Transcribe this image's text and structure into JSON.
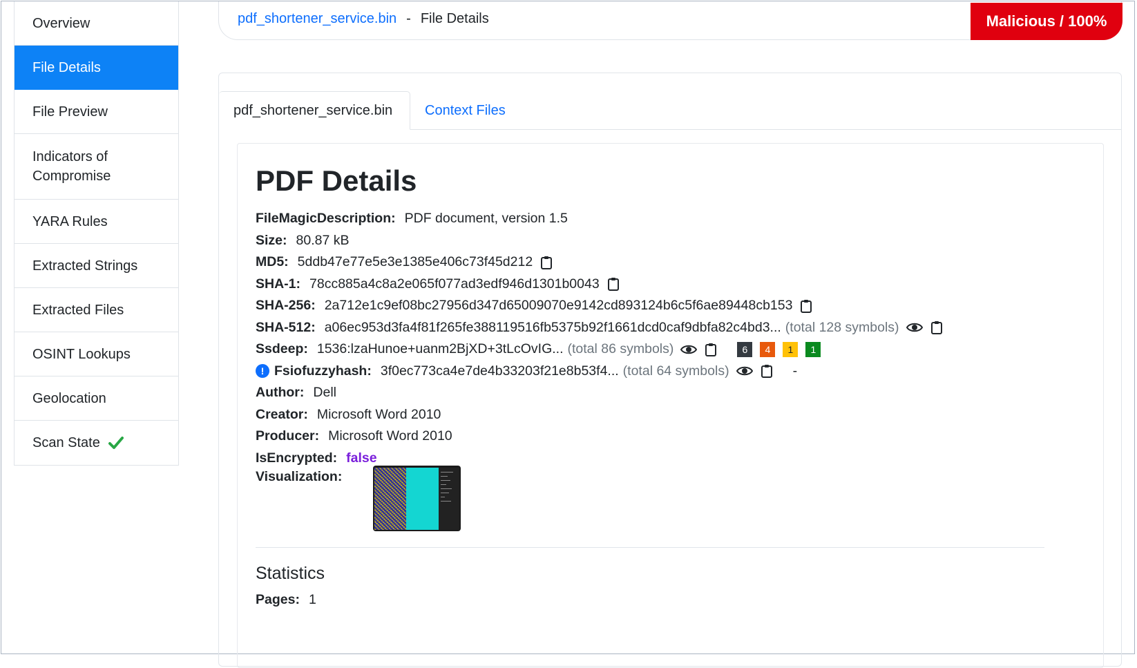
{
  "sidebar": {
    "items": [
      {
        "label": "Overview"
      },
      {
        "label": "File Details"
      },
      {
        "label": "File Preview"
      },
      {
        "label": "Indicators of Compromise"
      },
      {
        "label": "YARA Rules"
      },
      {
        "label": "Extracted Strings"
      },
      {
        "label": "Extracted Files"
      },
      {
        "label": "OSINT Lookups"
      },
      {
        "label": "Geolocation"
      },
      {
        "label": "Scan State"
      }
    ],
    "active_index": 1,
    "scan_state_icon": "check-icon",
    "scan_state_color": "#28a745"
  },
  "header": {
    "filename": "pdf_shortener_service.bin",
    "separator": "-",
    "section": "File Details",
    "verdict": "Malicious / 100%",
    "verdict_color": "#e0000f"
  },
  "tabs": [
    {
      "label": "pdf_shortener_service.bin"
    },
    {
      "label": "Context Files"
    }
  ],
  "details": {
    "title": "PDF Details",
    "file_magic": {
      "key": "FileMagicDescription:",
      "value": "PDF document, version 1.5"
    },
    "size": {
      "key": "Size:",
      "value": "80.87 kB"
    },
    "md5": {
      "key": "MD5:",
      "value": "5ddb47e77e5e3e1385e406c73f45d212"
    },
    "sha1": {
      "key": "SHA-1:",
      "value": "78cc885a4c8a2e065f077ad3edf946d1301b0043"
    },
    "sha256": {
      "key": "SHA-256:",
      "value": "2a712e1c9ef08bc27956d347d65009070e9142cd893124b6c5f6ae89448cb153"
    },
    "sha512": {
      "key": "SHA-512:",
      "value": "a06ec953d3fa4f81f265fe388119516fb5375b92f1661dcd0caf9dbfa82c4bd3...",
      "total": "(total 128 symbols)"
    },
    "ssdeep": {
      "key": "Ssdeep:",
      "value": "1536:lzaHunoe+uanm2BjXD+3tLcOvIG...",
      "total": "(total 86 symbols)",
      "badges": [
        {
          "value": "6",
          "color": "#343a40"
        },
        {
          "value": "4",
          "color": "#e8590c"
        },
        {
          "value": "1",
          "color": "#ffc107"
        },
        {
          "value": "1",
          "color": "#0a8a1f"
        }
      ]
    },
    "fsio": {
      "key": "Fsiofuzzyhash:",
      "value": "3f0ec773ca4e7de4b33203f21e8b53f4...",
      "total": "(total 64 symbols)",
      "trailing": "-",
      "info_icon": "!"
    },
    "author": {
      "key": "Author:",
      "value": "Dell"
    },
    "creator": {
      "key": "Creator:",
      "value": "Microsoft Word 2010"
    },
    "producer": {
      "key": "Producer:",
      "value": "Microsoft Word 2010"
    },
    "encrypted": {
      "key": "IsEncrypted:",
      "value": "false"
    },
    "visualization": {
      "key": "Visualization:"
    }
  },
  "statistics": {
    "title": "Statistics",
    "pages": {
      "key": "Pages:",
      "value": "1"
    }
  }
}
